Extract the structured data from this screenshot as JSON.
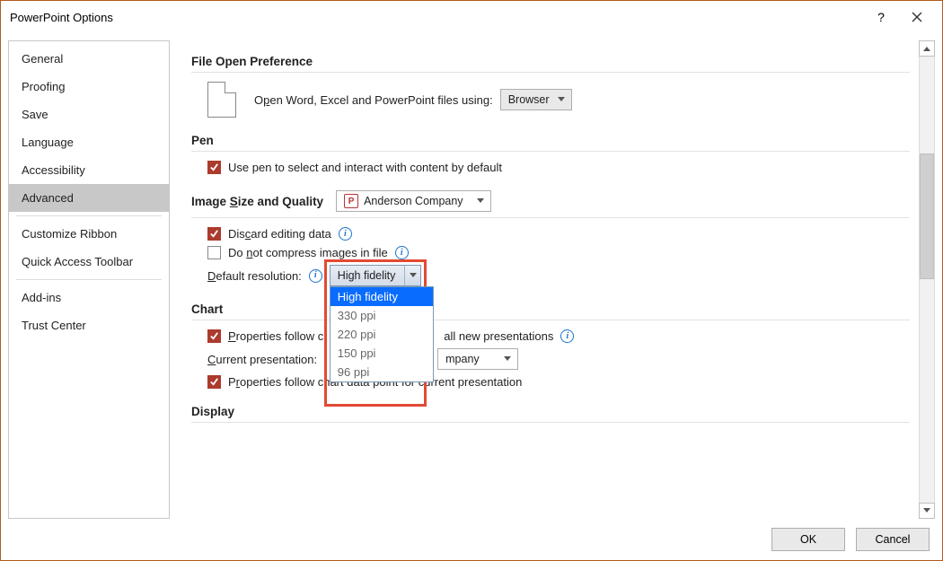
{
  "window": {
    "title": "PowerPoint Options"
  },
  "sidebar": {
    "items": [
      {
        "label": "General"
      },
      {
        "label": "Proofing"
      },
      {
        "label": "Save"
      },
      {
        "label": "Language"
      },
      {
        "label": "Accessibility"
      },
      {
        "label": "Advanced",
        "selected": true
      },
      {
        "label": "Customize Ribbon",
        "sepBefore": true
      },
      {
        "label": "Quick Access Toolbar"
      },
      {
        "label": "Add-ins",
        "sepBefore": true
      },
      {
        "label": "Trust Center"
      }
    ]
  },
  "sections": {
    "file_open": {
      "title": "File Open Preference",
      "label_pre": "O",
      "label_u": "p",
      "label_post": "en Word, Excel and PowerPoint files using:",
      "dropdown": "Browser"
    },
    "pen": {
      "title": "Pen",
      "use_pen_label": "Use pen to select and interact with content by default",
      "use_pen_checked": true
    },
    "image": {
      "title_pre": "Image ",
      "title_u": "S",
      "title_post": "ize and Quality",
      "doc_dropdown": "Anderson Company",
      "discard_pre": "Dis",
      "discard_u": "c",
      "discard_post": "ard editing data",
      "discard_checked": true,
      "nocompress_pre": "Do ",
      "nocompress_u": "n",
      "nocompress_post": "ot compress images in file",
      "nocompress_checked": false,
      "defres_u": "D",
      "defres_post": "efault resolution:",
      "defres_value": "High fidelity",
      "defres_options": [
        "High fidelity",
        "330 ppi",
        "220 ppi",
        "150 ppi",
        "96 ppi"
      ]
    },
    "chart": {
      "title": "Chart",
      "props_all_u": "P",
      "props_all_post": "roperties follow chart data point for all new presentations",
      "props_all_tail": "all new presentations",
      "props_all_checked": true,
      "current_u": "C",
      "current_post": "urrent presentation:",
      "current_dropdown_tail": "mpany",
      "props_cur_pre": "P",
      "props_cur_u": "r",
      "props_cur_post": "operties follow chart data point for current presentation",
      "props_cur_checked": true
    },
    "display": {
      "title": "Display"
    }
  },
  "footer": {
    "ok": "OK",
    "cancel": "Cancel"
  }
}
